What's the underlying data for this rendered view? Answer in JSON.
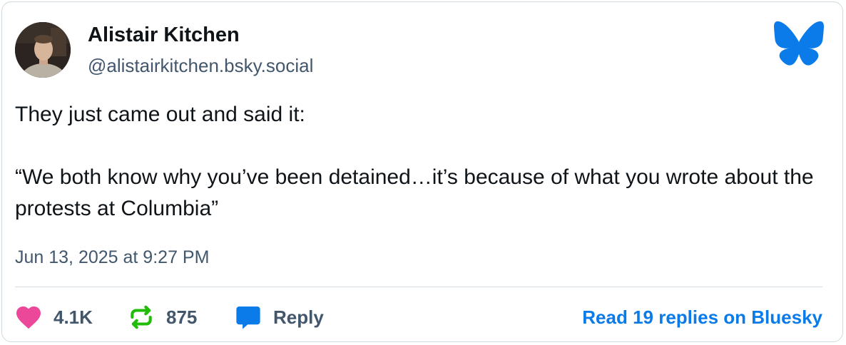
{
  "author": {
    "display_name": "Alistair Kitchen",
    "handle": "@alistairkitchen.bsky.social"
  },
  "post": {
    "line1": "They just came out and said it:",
    "line2": "“We both know why you’ve been detained…it’s because of what you wrote about the protests at Columbia”",
    "timestamp": "Jun 13, 2025 at 9:27 PM"
  },
  "engagement": {
    "likes": "4.1K",
    "reposts": "875",
    "reply_label": "Reply",
    "read_replies": "Read 19 replies on Bluesky"
  },
  "colors": {
    "brand": "#0b7bea",
    "like": "#ec4899",
    "repost": "#20bc07",
    "text": "#0f1419",
    "muted": "#42576c"
  },
  "icons": {
    "logo": "bluesky-butterfly-icon",
    "like": "heart-icon",
    "repost": "repost-icon",
    "reply": "speech-bubble-icon"
  }
}
